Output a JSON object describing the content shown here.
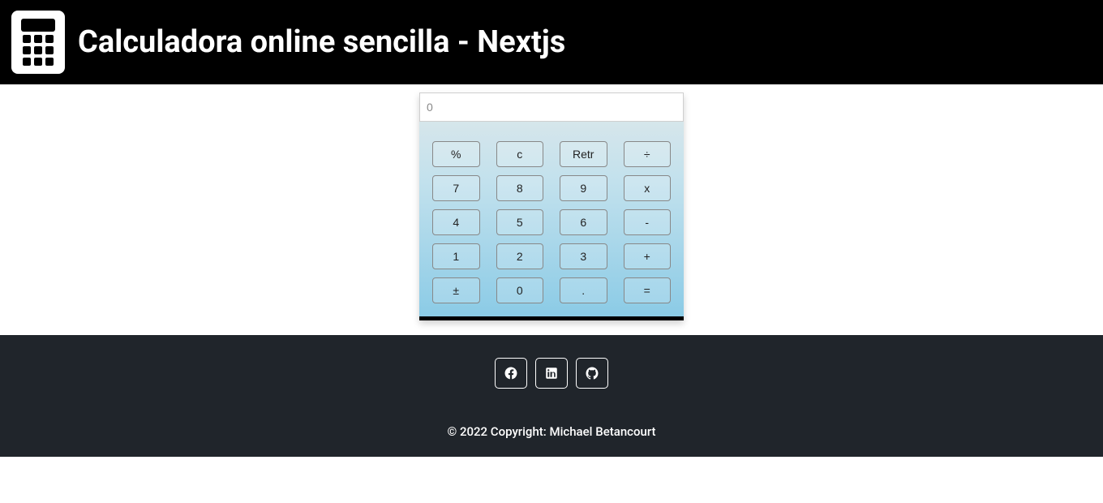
{
  "header": {
    "title": "Calculadora online sencilla - Nextjs"
  },
  "calculator": {
    "display_placeholder": "0",
    "display_value": "",
    "buttons": [
      [
        {
          "label": "%",
          "name": "percent-button"
        },
        {
          "label": "c",
          "name": "clear-button"
        },
        {
          "label": "Retr",
          "name": "backspace-button"
        },
        {
          "label": "÷",
          "name": "divide-button"
        }
      ],
      [
        {
          "label": "7",
          "name": "digit-7-button"
        },
        {
          "label": "8",
          "name": "digit-8-button"
        },
        {
          "label": "9",
          "name": "digit-9-button"
        },
        {
          "label": "x",
          "name": "multiply-button"
        }
      ],
      [
        {
          "label": "4",
          "name": "digit-4-button"
        },
        {
          "label": "5",
          "name": "digit-5-button"
        },
        {
          "label": "6",
          "name": "digit-6-button"
        },
        {
          "label": "-",
          "name": "subtract-button"
        }
      ],
      [
        {
          "label": "1",
          "name": "digit-1-button"
        },
        {
          "label": "2",
          "name": "digit-2-button"
        },
        {
          "label": "3",
          "name": "digit-3-button"
        },
        {
          "label": "+",
          "name": "add-button"
        }
      ],
      [
        {
          "label": "±",
          "name": "plusminus-button"
        },
        {
          "label": "0",
          "name": "digit-0-button"
        },
        {
          "label": ".",
          "name": "decimal-button"
        },
        {
          "label": "=",
          "name": "equals-button"
        }
      ]
    ]
  },
  "footer": {
    "social": [
      {
        "name": "facebook",
        "icon": "facebook-icon"
      },
      {
        "name": "linkedin",
        "icon": "linkedin-icon"
      },
      {
        "name": "github",
        "icon": "github-icon"
      }
    ],
    "copyright": "© 2022 Copyright: Michael Betancourt"
  }
}
